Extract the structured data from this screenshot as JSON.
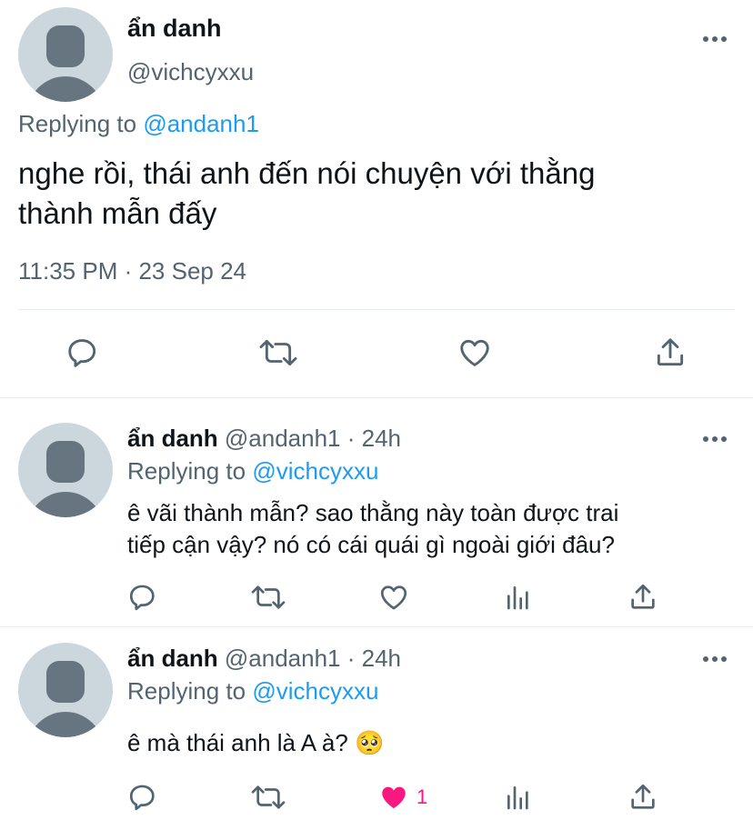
{
  "main": {
    "author_name": "ẩn danh",
    "author_handle": "@vichcyxxu",
    "replying_prefix": "Replying to",
    "replying_handle": "@andanh1",
    "text_line1": "nghe rồi, thái anh đến nói chuyện với thằng",
    "text_line2": "thành mẫn đấy",
    "timestamp": "11:35 PM · 23 Sep 24"
  },
  "replies": [
    {
      "name": "ẩn danh",
      "handle_time": "@andanh1 · 24h",
      "replying_prefix": "Replying to",
      "replying_handle": "@vichcyxxu",
      "text_line1": "ê vãi thành mẫn? sao thằng này toàn được trai",
      "text_line2": "tiếp cận vậy? nó có cái quái gì ngoài giới đâu?",
      "like_count": ""
    },
    {
      "name": "ẩn danh",
      "handle_time": "@andanh1 · 24h",
      "replying_prefix": "Replying to",
      "replying_handle": "@vichcyxxu",
      "text_line1": "ê mà thái anh là A à? 🥺",
      "like_count": "1",
      "liked": true
    }
  ],
  "colors": {
    "accent": "#1d9bf0",
    "muted": "#536471",
    "like": "#f91880"
  },
  "icons": [
    "reply-icon",
    "retweet-icon",
    "like-icon",
    "share-icon",
    "analytics-icon",
    "more-icon"
  ]
}
